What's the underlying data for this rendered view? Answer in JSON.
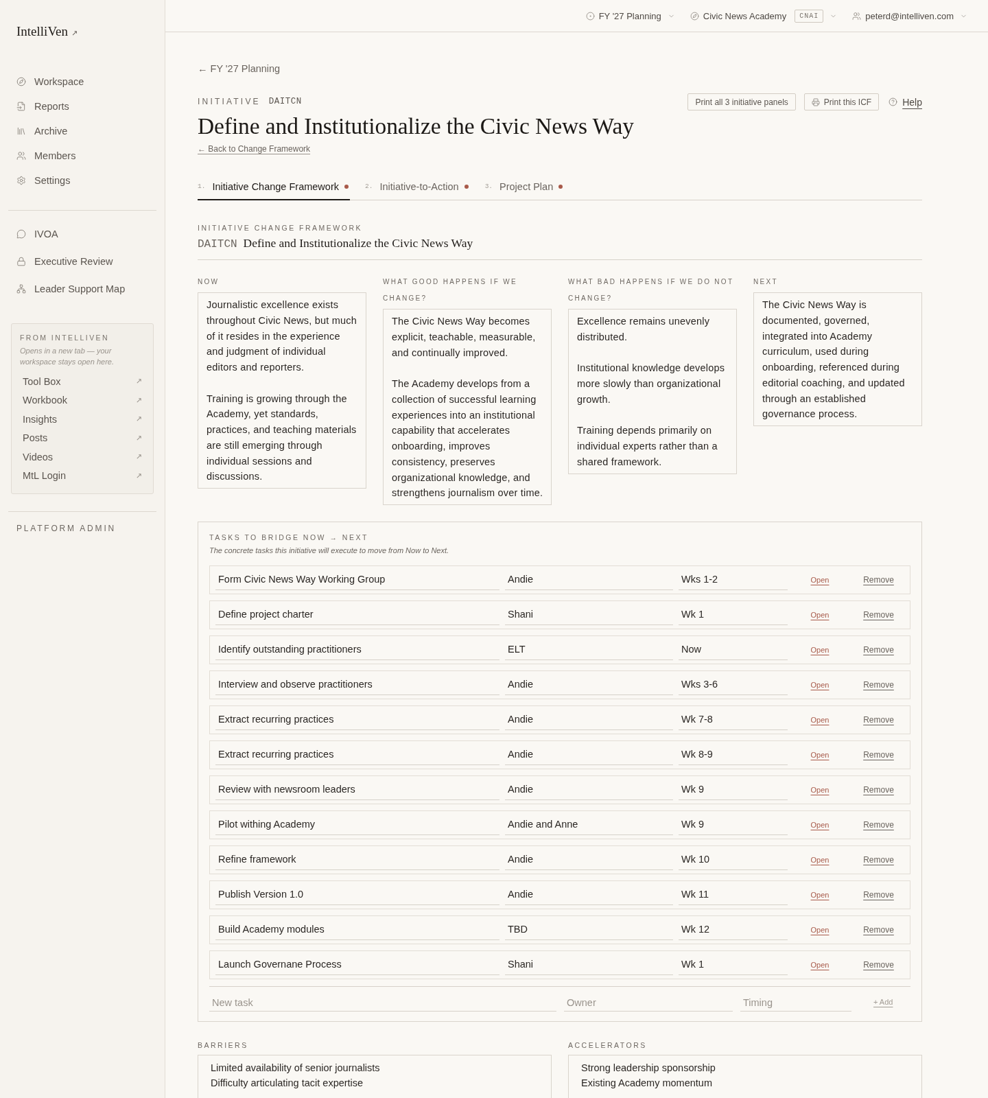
{
  "sidebar": {
    "logo": "IntelliVen",
    "logo_arrow": "↗",
    "nav": [
      "Workspace",
      "Reports",
      "Archive",
      "Members",
      "Settings"
    ],
    "tools": [
      "IVOA",
      "Executive Review",
      "Leader Support Map"
    ],
    "external": {
      "title": "FROM INTELLIVEN",
      "note": "Opens in a new tab — your workspace stays open here.",
      "links": [
        {
          "label": "Tool Box",
          "arrow": "↗"
        },
        {
          "label": "Workbook",
          "arrow": "↗"
        },
        {
          "label": "Insights",
          "arrow": "↗"
        },
        {
          "label": "Posts",
          "arrow": "↗"
        },
        {
          "label": "Videos",
          "arrow": "↗"
        },
        {
          "label": "MtL Login",
          "arrow": "↗"
        }
      ]
    },
    "admin_label": "PLATFORM ADMIN"
  },
  "topbar": {
    "menus": [
      {
        "label": "FY '27 Planning"
      },
      {
        "label": "Civic News Academy",
        "badge": "CNAI"
      },
      {
        "label": "peterd@intelliven.com"
      }
    ]
  },
  "header": {
    "breadcrumb": "← FY '27 Planning",
    "eyebrow": "INITIATIVE",
    "code": "DAITCN",
    "title": "Define and Institutionalize the Civic News Way",
    "back_link": "← Back to Change Framework",
    "actions": [
      {
        "kind": "plain",
        "label": "Print all 3 initiative panels"
      },
      {
        "kind": "icon",
        "label": "Print this ICF"
      }
    ],
    "help": "Help"
  },
  "tabs": [
    {
      "number": "1.",
      "label": "Initiative Change Framework",
      "selected": true,
      "flagged": true
    },
    {
      "number": "2.",
      "label": "Initiative-to-Action",
      "selected": false,
      "flagged": true
    },
    {
      "number": "3.",
      "label": "Project Plan",
      "selected": false,
      "flagged": true
    }
  ],
  "framework": {
    "eyebrow": "INITIATIVE CHANGE FRAMEWORK",
    "code": "DAITCN",
    "title": "Define and Institutionalize the Civic News Way",
    "columns": [
      {
        "heading": "NOW",
        "paragraphs": [
          "Journalistic excellence exists throughout Civic News, but much of it resides in the experience and judgment of individual editors and reporters.",
          "Training is growing through the Academy, yet standards, practices, and teaching materials are still emerging through individual sessions and discussions."
        ]
      },
      {
        "heading": "WHAT GOOD HAPPENS IF WE CHANGE?",
        "paragraphs": [
          "The Civic News Way becomes explicit, teachable, measurable, and continually improved.",
          "The Academy develops from a collection of successful learning experiences into an institutional capability that accelerates onboarding, improves consistency, preserves organizational knowledge, and strengthens journalism over time."
        ]
      },
      {
        "heading": "WHAT BAD HAPPENS IF WE DO NOT CHANGE?",
        "paragraphs": [
          "Excellence remains unevenly distributed.",
          "Institutional knowledge develops more slowly than organizational growth.",
          "Training depends primarily on individual experts rather than a shared framework."
        ]
      },
      {
        "heading": "NEXT",
        "paragraphs": [
          "The Civic News Way is documented, governed, integrated into Academy curriculum, used during onboarding, referenced during editorial coaching, and updated through an established governance process."
        ]
      }
    ]
  },
  "tasks": {
    "heading": "TASKS TO BRIDGE NOW → NEXT",
    "note": "The concrete tasks this initiative will execute to move from Now to Next.",
    "rows": [
      {
        "task": "Form Civic News Way Working Group",
        "owner": "Andie",
        "timing": "Wks 1-2",
        "open": "Open",
        "remove": "Remove"
      },
      {
        "task": "Define project charter",
        "owner": "Shani",
        "timing": "Wk 1",
        "open": "Open",
        "remove": "Remove"
      },
      {
        "task": "Identify outstanding practitioners",
        "owner": "ELT",
        "timing": "Now",
        "open": "Open",
        "remove": "Remove"
      },
      {
        "task": "Interview and observe practitioners",
        "owner": "Andie",
        "timing": "Wks 3-6",
        "open": "Open",
        "remove": "Remove"
      },
      {
        "task": "Extract recurring practices",
        "owner": "Andie",
        "timing": "Wk 7-8",
        "open": "Open",
        "remove": "Remove"
      },
      {
        "task": "Extract recurring practices",
        "owner": "Andie",
        "timing": "Wk 8-9",
        "open": "Open",
        "remove": "Remove"
      },
      {
        "task": "Review with newsroom leaders",
        "owner": "Andie",
        "timing": "Wk 9",
        "open": "Open",
        "remove": "Remove"
      },
      {
        "task": "Pilot withing Academy",
        "owner": "Andie and Anne",
        "timing": "Wk 9",
        "open": "Open",
        "remove": "Remove"
      },
      {
        "task": "Refine framework",
        "owner": "Andie",
        "timing": "Wk 10",
        "open": "Open",
        "remove": "Remove"
      },
      {
        "task": "Publish Version 1.0",
        "owner": "Andie",
        "timing": "Wk 11",
        "open": "Open",
        "remove": "Remove"
      },
      {
        "task": "Build Academy modules",
        "owner": "TBD",
        "timing": "Wk 12",
        "open": "Open",
        "remove": "Remove"
      },
      {
        "task": "Launch Governane Process",
        "owner": "Shani",
        "timing": "Wk 1",
        "open": "Open",
        "remove": "Remove"
      }
    ],
    "new_row": {
      "task_placeholder": "New task",
      "owner_placeholder": "Owner",
      "timing_placeholder": "Timing",
      "add": "+ Add"
    }
  },
  "barriers": {
    "heading": "BARRIERS",
    "items": [
      "Limited availability of senior journalists",
      "Difficulty articulating tacit expertise"
    ]
  },
  "accelerators": {
    "heading": "ACCELERATORS",
    "items": [
      "Strong leadership sponsorship",
      "Existing Academy momentum"
    ]
  }
}
